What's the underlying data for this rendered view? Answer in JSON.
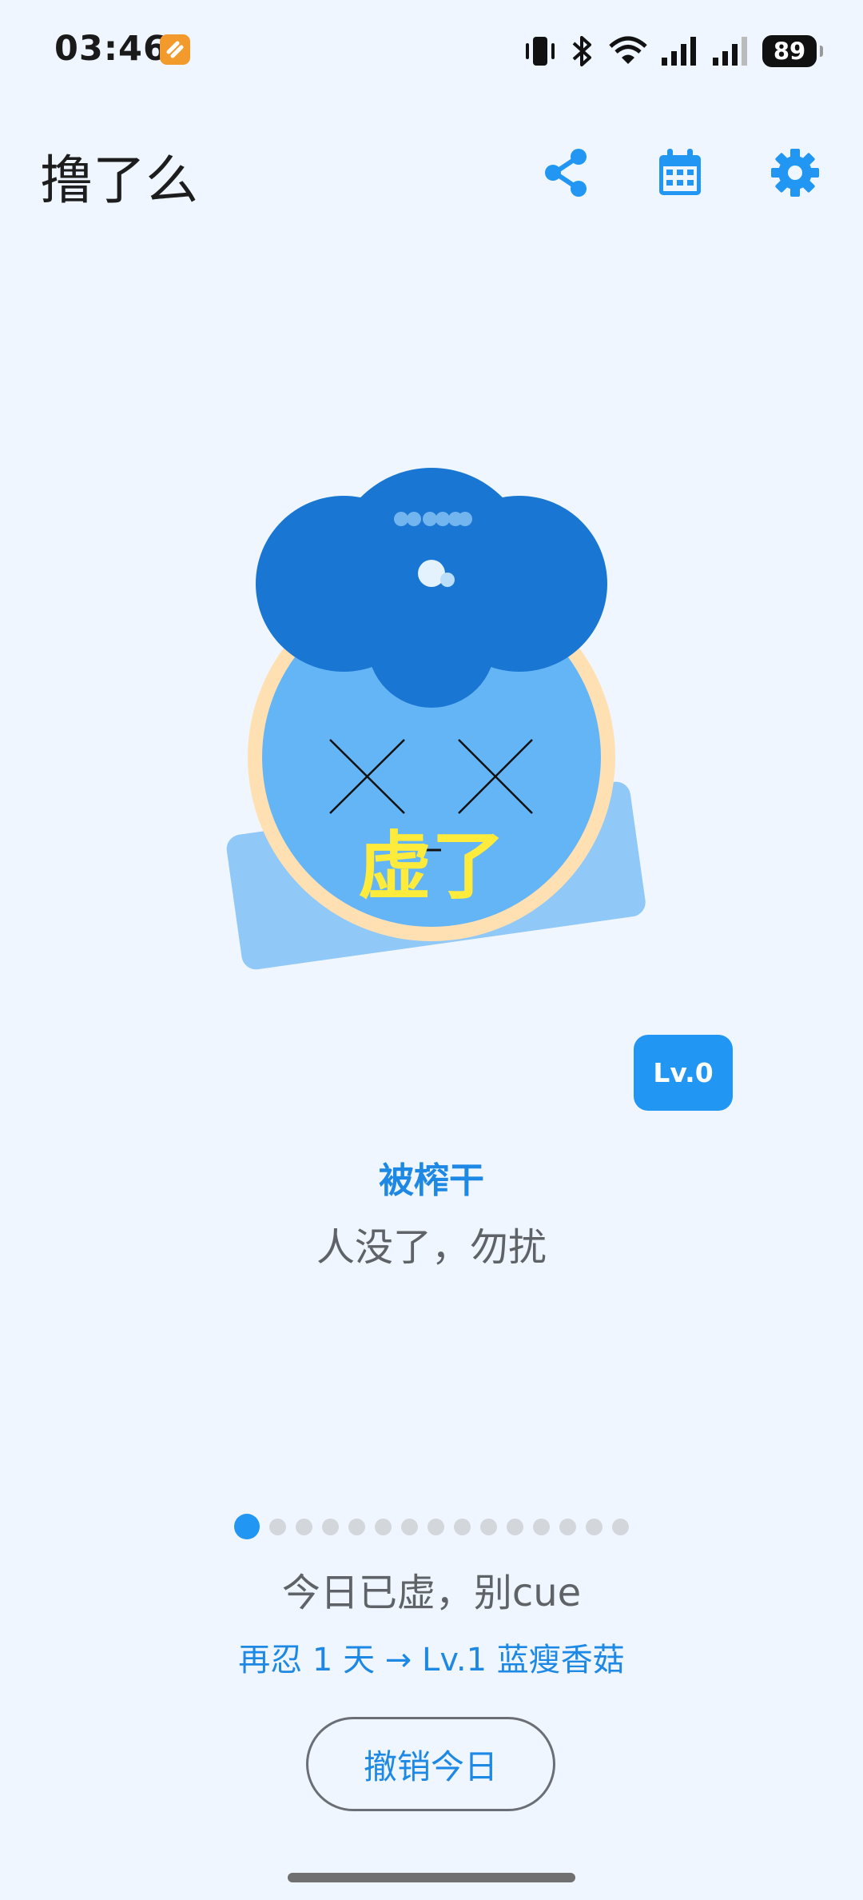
{
  "status_bar": {
    "time": "03:46",
    "battery": "89"
  },
  "app_bar": {
    "title": "撸了么",
    "icons": [
      "share-icon",
      "calendar-icon",
      "gear-icon"
    ],
    "accent_color": "#2196F3"
  },
  "mascot": {
    "caption": "虚了",
    "icon": "mascot-illustration"
  },
  "level": {
    "badge": "Lv.0"
  },
  "state": {
    "title": "被榨干",
    "subtitle": "人没了，勿扰"
  },
  "progress": {
    "total_dots": 15,
    "active_index": 0
  },
  "today": {
    "message": "今日已虚，别cue",
    "next_level": "再忍 1 天 → Lv.1 蓝瘦香菇"
  },
  "actions": {
    "undo_label": "撤销今日"
  }
}
